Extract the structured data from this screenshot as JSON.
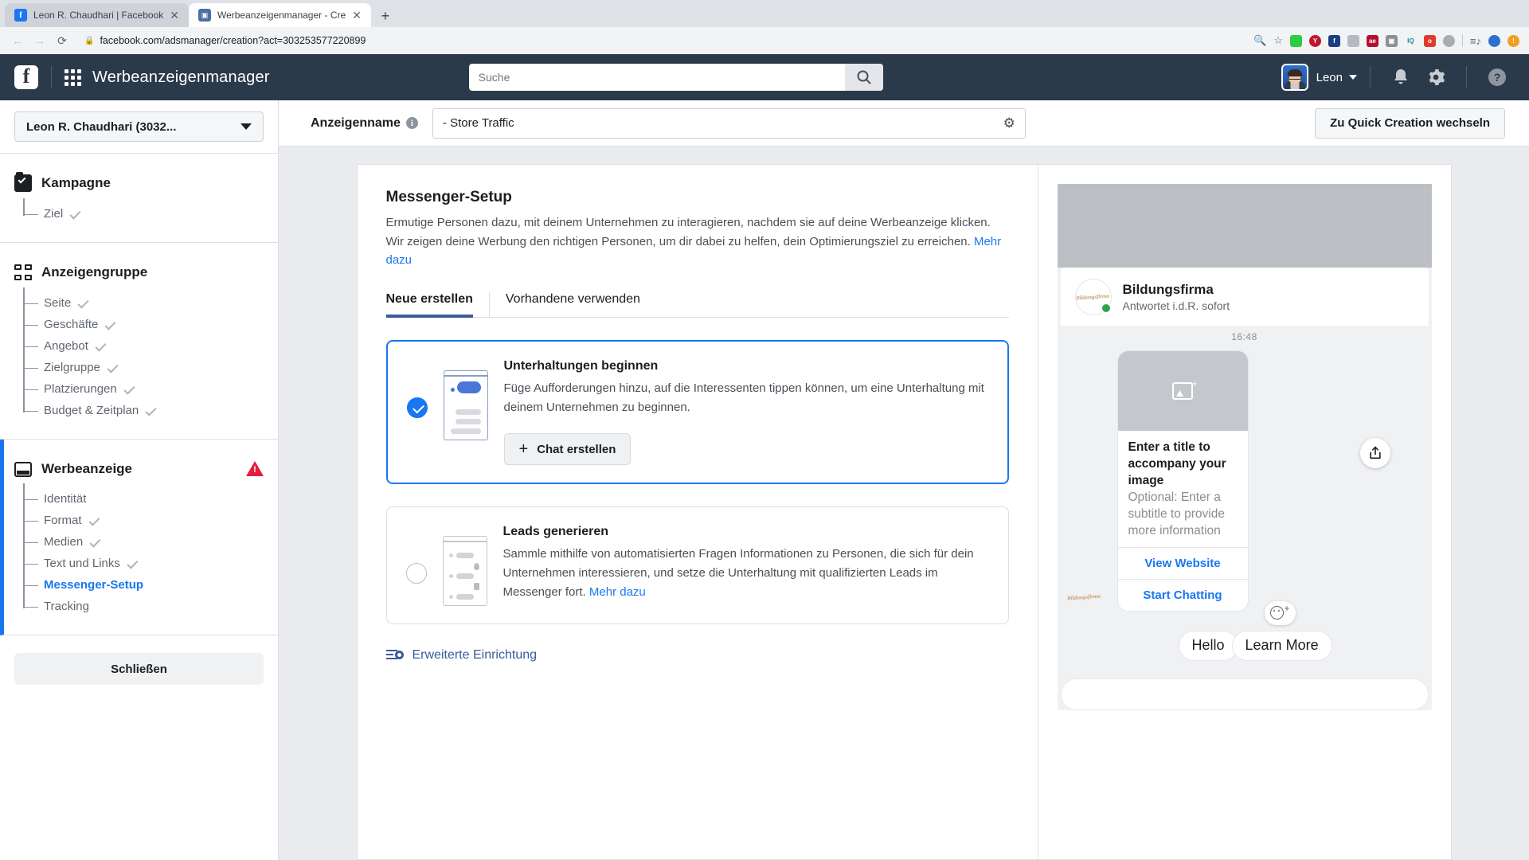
{
  "browser": {
    "tabs": [
      {
        "title": "Leon R. Chaudhari | Facebook",
        "favicon": "facebook-icon",
        "active": false
      },
      {
        "title": "Werbeanzeigenmanager - Cre",
        "favicon": "adsmanager-icon",
        "active": true
      }
    ],
    "new_tab_label": "+",
    "url": "facebook.com/adsmanager/creation?act=303253577220899",
    "nav": {
      "back": "←",
      "forward": "→",
      "reload": "⟳"
    },
    "extensions": [
      "zoom-icon",
      "bookmark-star-icon",
      "ext-green-shield",
      "ext-yab-red",
      "ext-facebook",
      "ext-gray-runner",
      "ext-ae-red",
      "ext-gray-window",
      "ext-iq-teal",
      "ext-off-green",
      "ext-abp-gray",
      "ext-playlist",
      "ext-avatar",
      "ext-orange-alert"
    ]
  },
  "header": {
    "logo": "facebook-logo",
    "grid": "app-grid-icon",
    "title": "Werbeanzeigenmanager",
    "search_placeholder": "Suche",
    "search_value": "",
    "search_icon": "search-icon",
    "user_name": "Leon",
    "bell": "notifications-icon",
    "gear": "settings-icon",
    "help": "?"
  },
  "sidebar": {
    "account": "Leon R. Chaudhari (3032...",
    "sections": [
      {
        "title": "Kampagne",
        "icon": "campaign-checkbox-icon",
        "warning": false,
        "items": [
          {
            "label": "Ziel",
            "done": true,
            "current": false
          }
        ]
      },
      {
        "title": "Anzeigengruppe",
        "icon": "adset-grid-icon",
        "warning": false,
        "items": [
          {
            "label": "Seite",
            "done": true,
            "current": false
          },
          {
            "label": "Geschäfte",
            "done": true,
            "current": false
          },
          {
            "label": "Angebot",
            "done": true,
            "current": false
          },
          {
            "label": "Zielgruppe",
            "done": true,
            "current": false
          },
          {
            "label": "Platzierungen",
            "done": true,
            "current": false
          },
          {
            "label": "Budget & Zeitplan",
            "done": true,
            "current": false
          }
        ]
      },
      {
        "title": "Werbeanzeige",
        "icon": "ad-screen-icon",
        "warning": true,
        "warning_icon": "warning-triangle-icon",
        "items": [
          {
            "label": "Identität",
            "done": false,
            "current": false
          },
          {
            "label": "Format",
            "done": true,
            "current": false
          },
          {
            "label": "Medien",
            "done": true,
            "current": false
          },
          {
            "label": "Text und Links",
            "done": true,
            "current": false
          },
          {
            "label": "Messenger-Setup",
            "done": false,
            "current": true
          },
          {
            "label": "Tracking",
            "done": false,
            "current": false
          }
        ]
      }
    ],
    "close_label": "Schließen"
  },
  "topbar": {
    "adname_label": "Anzeigenname",
    "info_icon": "info-icon",
    "adname_value": "- Store Traffic",
    "gear_icon": "gear-icon",
    "quick_creation_label": "Zu Quick Creation wechseln"
  },
  "panel": {
    "heading": "Messenger-Setup",
    "description": "Ermutige Personen dazu, mit deinem Unternehmen zu interagieren, nachdem sie auf deine Werbeanzeige klicken. Wir zeigen deine Werbung den richtigen Personen, um dir dabei zu helfen, dein Optimierungsziel zu erreichen.",
    "description_link": "Mehr dazu",
    "tabs": [
      {
        "label": "Neue erstellen",
        "active": true
      },
      {
        "label": "Vorhandene verwenden",
        "active": false
      }
    ],
    "options": [
      {
        "title": "Unterhaltungen beginnen",
        "description": "Füge Aufforderungen hinzu, auf die Interessenten tippen können, um eine Unterhaltung mit deinem Unternehmen zu beginnen.",
        "selected": true,
        "button_label": "Chat erstellen",
        "button_icon": "plus-icon",
        "link": ""
      },
      {
        "title": "Leads generieren",
        "description": "Sammle mithilfe von automatisierten Fragen Informationen zu Personen, die sich für dein Unternehmen interessieren, und setze die Unterhaltung mit qualifizierten Leads im Messenger fort.",
        "selected": false,
        "button_label": "",
        "link": "Mehr dazu"
      }
    ],
    "advanced_label": "Erweiterte Einrichtung",
    "advanced_icon": "sliders-gear-icon"
  },
  "preview": {
    "business_name": "Bildungsfirma",
    "business_status": "Antwortet i.d.R. sofort",
    "business_mark": "Bildungsfirma",
    "online_indicator": "online-dot",
    "timestamp": "16:48",
    "share_icon": "share-icon",
    "image_placeholder_icon": "add-image-icon",
    "ad_title": "Enter a title to accompany your image",
    "ad_subtitle": "Optional: Enter a subtitle to provide more information",
    "ctas": [
      "View Website",
      "Start Chatting"
    ],
    "reaction_icon": "add-reaction-icon",
    "quick_replies": [
      "Hello",
      "Learn More"
    ]
  },
  "colors": {
    "fb_blue": "#1877f2",
    "header_bg": "#2b3a4a",
    "online_green": "#31a24c",
    "warning_red": "#e41e3f"
  }
}
